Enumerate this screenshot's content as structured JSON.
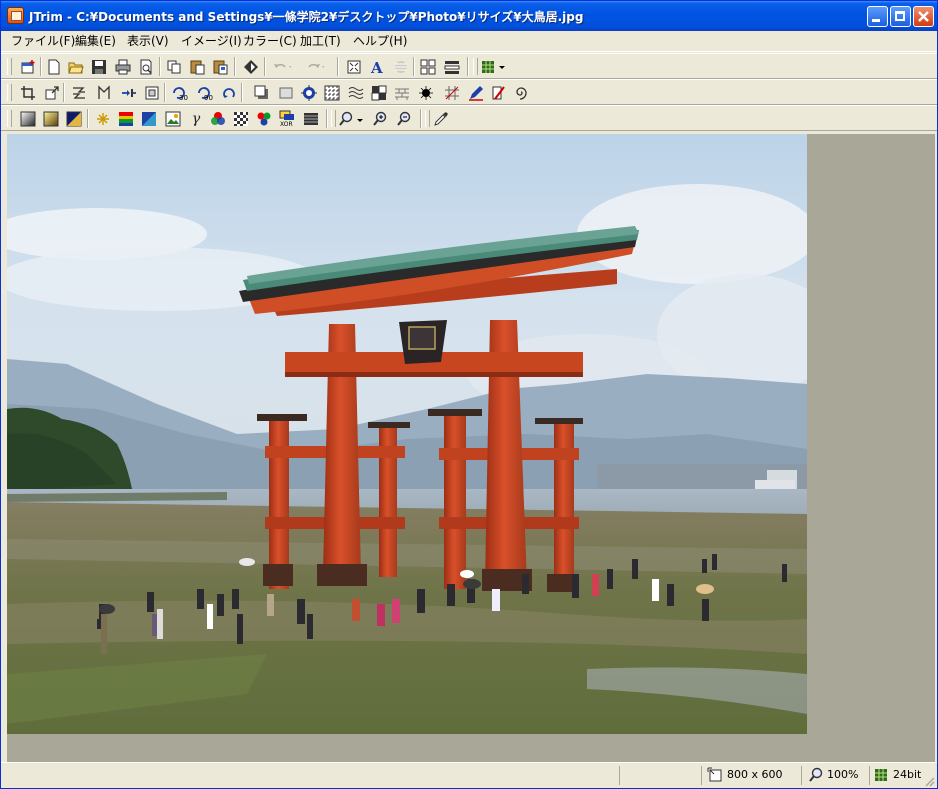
{
  "window": {
    "title": "JTrim - C:¥Documents and Settings¥一條学院2¥デスクトップ¥Photo¥リサイズ¥大鳥居.jpg"
  },
  "menu": [
    "ファイル(F)",
    "編集(E)",
    "表示(V)",
    "イメージ(I)",
    "カラー(C)",
    "加工(T)",
    "ヘルプ(H)"
  ],
  "status": {
    "size": "800 x 600",
    "zoom": "100%",
    "depth": "24bit"
  },
  "colors": {
    "titlebar": "#0054e3",
    "canvas_bg": "#a9a898",
    "face": "#ece9d8"
  },
  "icons": {
    "row1": [
      "new-window-icon",
      "new-file-icon",
      "open-icon",
      "save-icon",
      "print-icon",
      "print-preview-icon",
      "copy-icon",
      "paste-icon",
      "paste-new-icon",
      "diamond-tool-icon",
      "undo-icon",
      "redo-icon",
      "fit-icon",
      "text-icon",
      "blank-icon",
      "grid-icon",
      "list-icon",
      "color-grid-icon"
    ],
    "row2": [
      "crop-icon",
      "resize-icon",
      "flip-horizontal-icon",
      "flip-vertical-icon",
      "shrink-icon",
      "frame-icon",
      "rotate-30-icon",
      "rotate-90-icon",
      "rotate-free-icon",
      "shadow-icon",
      "border-icon",
      "blur-icon",
      "mosaic-icon",
      "wave-icon",
      "emboss-icon",
      "brick-icon",
      "sharpen-icon",
      "grid-line-icon",
      "pen-icon",
      "eraser-icon",
      "spiral-icon"
    ],
    "row3": [
      "gradient-icon",
      "gold-icon",
      "tri-gradient-icon",
      "sparkle-icon",
      "rgb-icon",
      "monotone-icon",
      "landscape-icon",
      "gamma-icon",
      "hue-icon",
      "checker-icon",
      "balance-icon",
      "xor-icon",
      "levels-icon",
      "zoom-icon",
      "zoom-in-icon",
      "zoom-out-icon",
      "eyedropper-icon"
    ]
  }
}
